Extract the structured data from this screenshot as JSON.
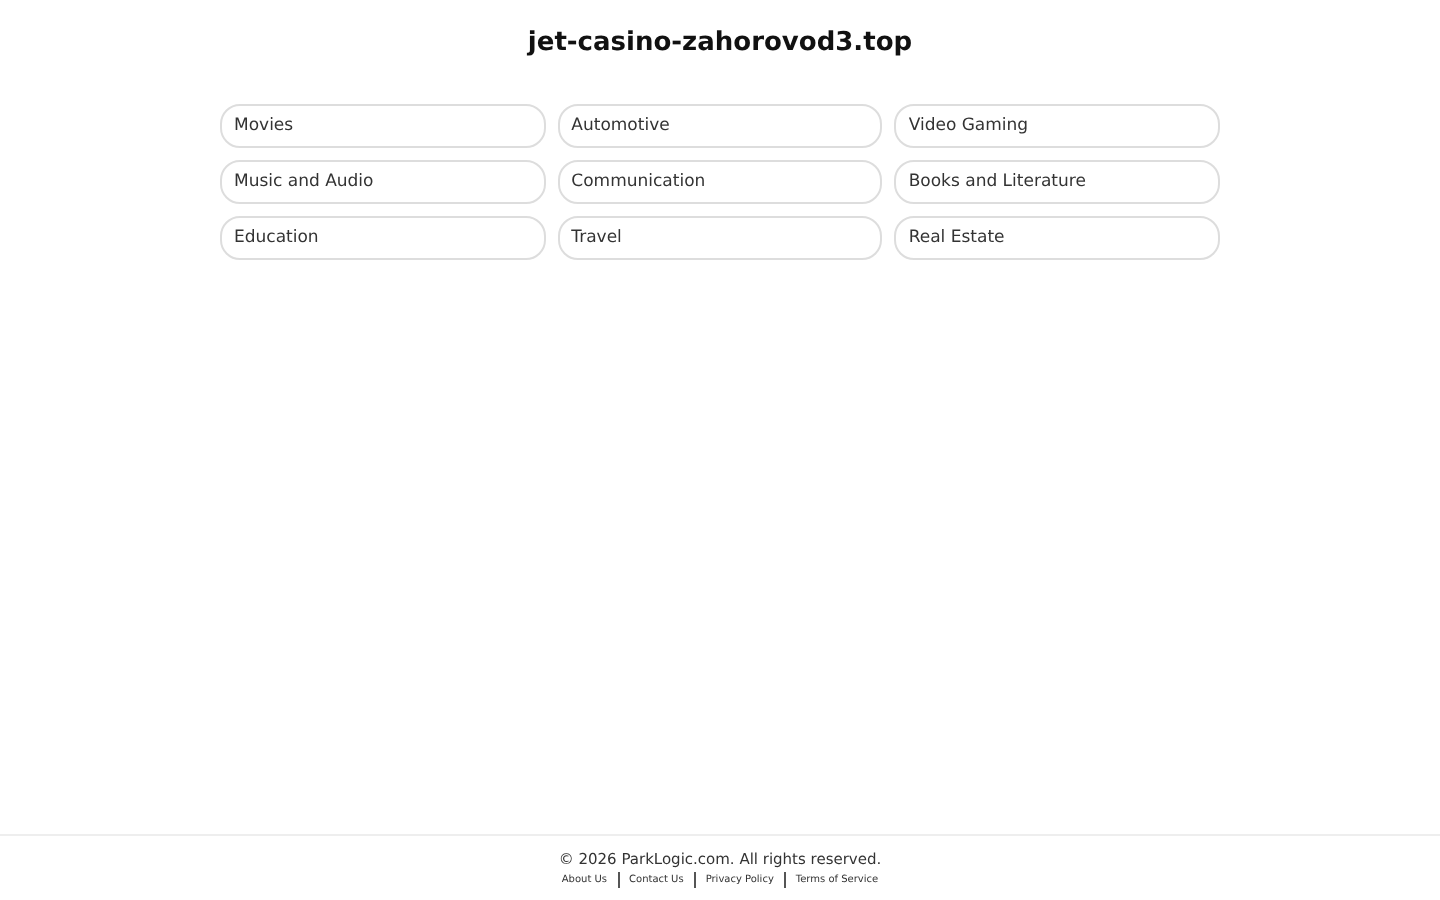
{
  "title": "jet-casino-zahorovod3.top",
  "links": [
    "Movies",
    "Automotive",
    "Video Gaming",
    "Music and Audio",
    "Communication",
    "Books and Literature",
    "Education",
    "Travel",
    "Real Estate"
  ],
  "footer": {
    "copyright": "© 2026 ParkLogic.com. All rights reserved.",
    "links": [
      "About Us",
      "Contact Us",
      "Privacy Policy",
      "Terms of Service"
    ]
  }
}
